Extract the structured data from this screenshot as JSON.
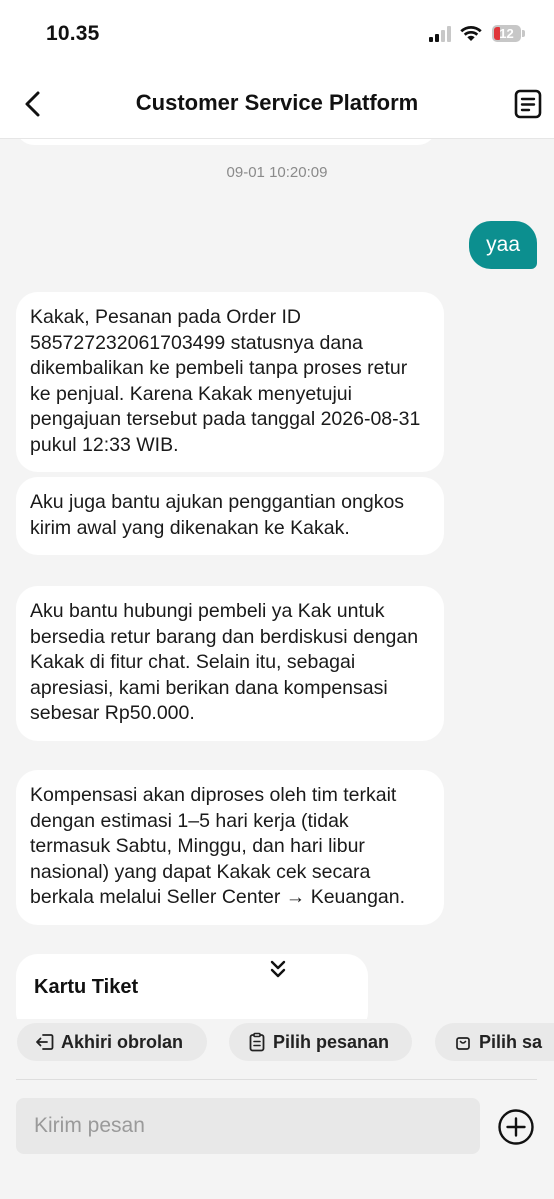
{
  "status_bar": {
    "time": "10.35",
    "battery_level": "12"
  },
  "header": {
    "title": "Customer Service Platform"
  },
  "chat": {
    "timestamp": "09-01 10:20:09",
    "messages": [
      {
        "from": "me",
        "text": "yaa"
      },
      {
        "from": "agent",
        "text": "Kakak, Pesanan pada Order ID 585727232061703499 statusnya dana dikembalikan ke pembeli tanpa proses retur ke penjual. Karena Kakak menyetujui pengajuan tersebut pada tanggal 2026-08-31 pukul 12:33 WIB."
      },
      {
        "from": "agent",
        "text": " Aku juga bantu ajukan penggantian ongkos kirim awal yang dikenakan ke Kakak."
      },
      {
        "from": "agent",
        "text": "Aku bantu hubungi pembeli ya Kak untuk bersedia retur barang dan berdiskusi dengan Kakak di fitur chat. Selain itu, sebagai apresiasi, kami berikan dana kompensasi sebesar Rp50.000."
      },
      {
        "from": "agent",
        "text": "Kompensasi akan diproses oleh tim terkait dengan estimasi 1–5 hari kerja (tidak termasuk Sabtu, Minggu, dan hari libur nasional) yang dapat Kakak cek secara berkala melalui Seller Center → Keuangan."
      }
    ],
    "ticket_card_title": "Kartu Tiket"
  },
  "quick_actions": [
    {
      "label": "Akhiri obrolan",
      "icon": "exit-icon"
    },
    {
      "label": "Pilih pesanan",
      "icon": "clipboard-icon"
    },
    {
      "label": "Pilih sa",
      "icon": "bag-icon"
    }
  ],
  "composer": {
    "placeholder": "Kirim pesan"
  },
  "colors": {
    "accent": "#0c8f8f",
    "background": "#f4f4f4",
    "bubble": "#ffffff",
    "battery_low": "#e0363a"
  }
}
